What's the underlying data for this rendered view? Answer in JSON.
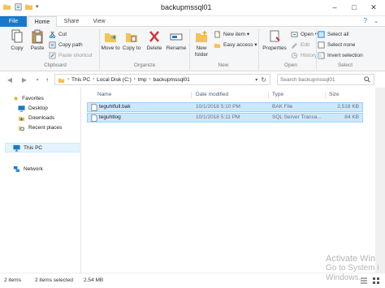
{
  "window": {
    "title": "backupmssql01",
    "controls": {
      "minimize": "–",
      "maximize": "□",
      "close": "✕"
    }
  },
  "ribbon_tabs": [
    "File",
    "Home",
    "Share",
    "View"
  ],
  "ribbon": {
    "clipboard": {
      "copy": "Copy",
      "paste": "Paste",
      "cut": "Cut",
      "copy_path": "Copy path",
      "paste_shortcut": "Paste shortcut",
      "label": "Clipboard"
    },
    "organize": {
      "move_to": "Move to",
      "copy_to": "Copy to",
      "delete": "Delete",
      "rename": "Rename",
      "label": "Organize"
    },
    "new": {
      "new_folder": "New folder",
      "new_item": "New item ▾",
      "easy_access": "Easy access ▾",
      "label": "New"
    },
    "open": {
      "properties": "Properties",
      "open": "Open ▾",
      "edit": "Edit",
      "history": "History",
      "label": "Open"
    },
    "select": {
      "select_all": "Select all",
      "select_none": "Select none",
      "invert": "Invert selection",
      "label": "Select"
    }
  },
  "address": {
    "crumbs": [
      "This PC",
      "Local Disk (C:)",
      "tmp",
      "backupmssql01"
    ],
    "search_placeholder": "Search backupmssql01"
  },
  "nav_pane": {
    "favorites": "Favorites",
    "desktop": "Desktop",
    "downloads": "Downloads",
    "recent": "Recent places",
    "this_pc": "This PC",
    "network": "Network"
  },
  "columns": {
    "name": "Name",
    "date": "Date modified",
    "type": "Type",
    "size": "Size"
  },
  "files": [
    {
      "name": "teguhtfull.bak",
      "date": "10/1/2018 5:10 PM",
      "type": "BAK File",
      "size": "2,518 KB"
    },
    {
      "name": "teguhtlog",
      "date": "10/1/2018 5:11 PM",
      "type": "SQL Server Transa...",
      "size": "84 KB"
    }
  ],
  "status": {
    "count": "2 items",
    "selected": "2 items selected",
    "size": "2.54 MB"
  },
  "watermark": {
    "line1": "Activate Win",
    "line2": "Go to System i",
    "line3": "Windows."
  },
  "colors": {
    "accent": "#1979ca",
    "selection": "#cce8ff",
    "folder": "#f4c357"
  }
}
